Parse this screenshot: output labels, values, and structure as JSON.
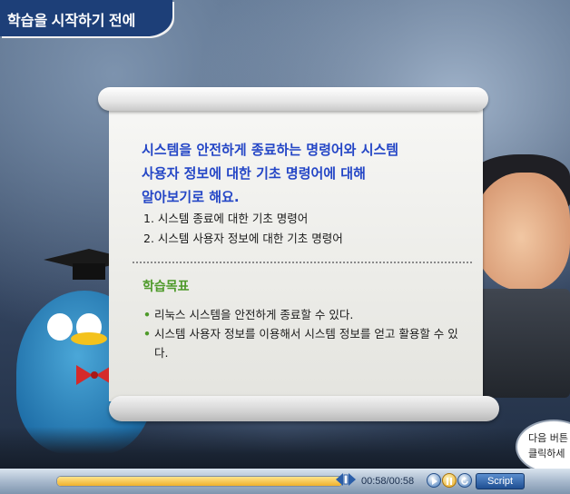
{
  "header": {
    "title": "학습을 시작하기 전에"
  },
  "scroll": {
    "intro_lines": [
      "시스템을 안전하게 종료하는 명령어와 시스템",
      "사용자 정보에 대한 기초 명령어에 대해",
      "알아보기로 해요."
    ],
    "toc": [
      "1. 시스템 종료에 대한 기초 명령어",
      "2. 시스템 사용자 정보에 대한 기초 명령어"
    ],
    "goal_heading": "학습목표",
    "goals": [
      "리눅스 시스템을 안전하게 종료할 수 있다.",
      "시스템 사용자 정보를 이용해서 시스템 정보를 얻고 활용할 수 있다."
    ]
  },
  "bubble": {
    "line1": "다음 버튼",
    "line2": "클릭하세"
  },
  "player": {
    "time": "00:58/00:58",
    "progress": 1.0,
    "script_label": "Script"
  },
  "colors": {
    "intro_text": "#2446c6",
    "goal_heading": "#4e9a2a",
    "title_banner": "#1d3f78"
  },
  "icons": [
    "graduation-cap-icon",
    "bowtie-icon",
    "play-icon",
    "pause-icon",
    "replay-icon",
    "progress-knob-icon"
  ]
}
